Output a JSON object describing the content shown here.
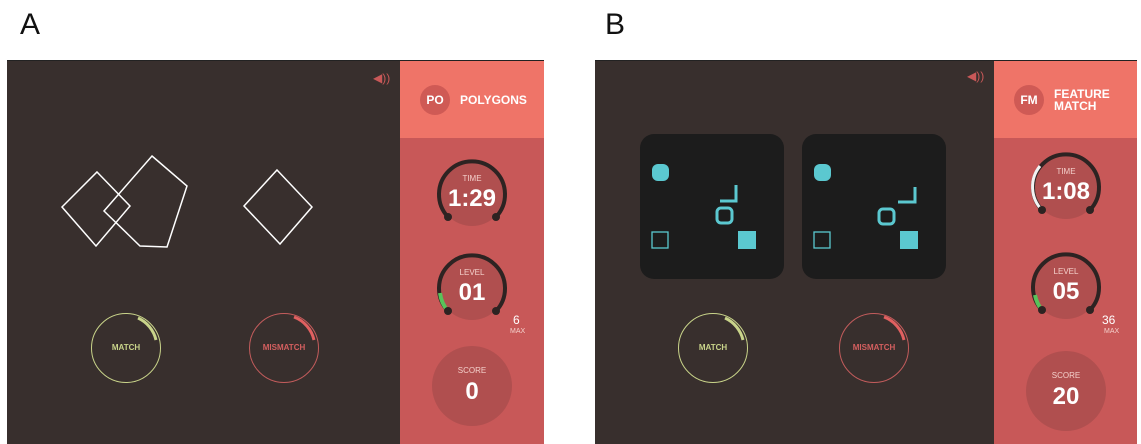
{
  "panels": [
    {
      "letter": "A",
      "game": {
        "badge": "PO",
        "name": "POLYGONS"
      },
      "time": {
        "label": "TIME",
        "value": "1:29"
      },
      "level": {
        "label": "LEVEL",
        "value": "01",
        "max": "6",
        "max_label": "MAX",
        "progress": 0.12
      },
      "score": {
        "label": "SCORE",
        "value": "0"
      },
      "buttons": {
        "match": "MATCH",
        "mismatch": "MISMATCH"
      },
      "sound_icon": "speaker-icon"
    },
    {
      "letter": "B",
      "game": {
        "badge": "FM",
        "name": "FEATURE\nMATCH"
      },
      "time": {
        "label": "TIME",
        "value": "1:08",
        "progress": 0.2
      },
      "level": {
        "label": "LEVEL",
        "value": "05",
        "max": "36",
        "max_label": "MAX",
        "progress": 0.1
      },
      "score": {
        "label": "SCORE",
        "value": "20"
      },
      "buttons": {
        "match": "MATCH",
        "mismatch": "MISMATCH"
      },
      "sound_icon": "speaker-icon"
    }
  ],
  "colors": {
    "screen_bg": "#382f2d",
    "sidebar": "#c85858",
    "sidebar_header": "#ef7468",
    "match": "#c9d48a",
    "mismatch": "#c35c5c",
    "card_bg": "#1c1c1c",
    "shape_teal": "#5bc8d0"
  }
}
